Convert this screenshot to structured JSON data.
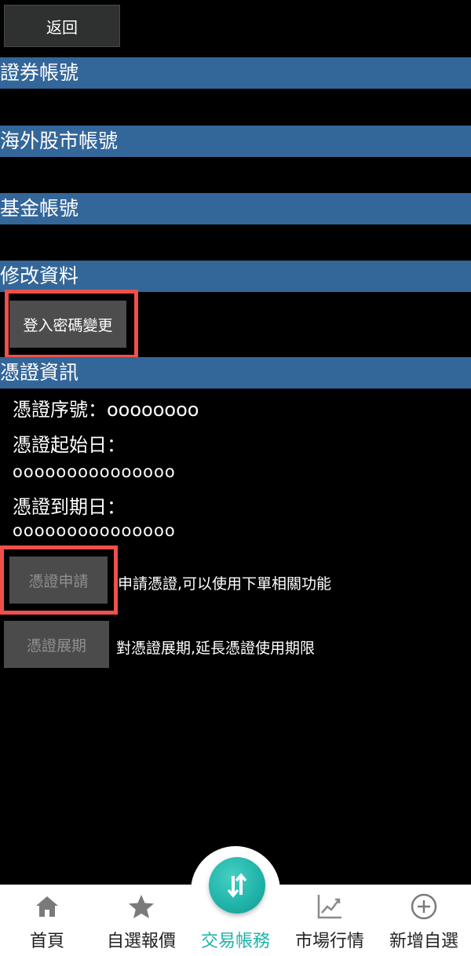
{
  "header": {
    "back_label": "返回"
  },
  "sections": {
    "securities_account": "證券帳號",
    "overseas_account": "海外股市帳號",
    "fund_account": "基金帳號",
    "modify_data": "修改資料",
    "certificate_info": "憑證資訊"
  },
  "modify": {
    "change_password_label": "登入密碼變更"
  },
  "certificate": {
    "serial_line": "憑證序號：oooooooo",
    "start_label": "憑證起始日：",
    "start_value": "ooooooooooooooo",
    "expiry_label": "憑證到期日：",
    "expiry_value": "ooooooooooooooo",
    "apply_label": "憑證申請",
    "apply_desc": "申請憑證,可以使用下單相關功能",
    "renew_label": "憑證展期",
    "renew_desc": "對憑證展期,延長憑證使用期限"
  },
  "nav": {
    "items": [
      {
        "label": "首頁",
        "icon": "home-icon"
      },
      {
        "label": "自選報價",
        "icon": "star-icon"
      },
      {
        "label": "交易帳務",
        "icon": "trade-arrows-icon",
        "active": true
      },
      {
        "label": "市場行情",
        "icon": "trend-chart-icon"
      },
      {
        "label": "新增自選",
        "icon": "plus-circle-icon"
      }
    ]
  },
  "colors": {
    "section_bar": "#336699",
    "highlight": "#f0504a",
    "accent": "#1fb2a8"
  }
}
